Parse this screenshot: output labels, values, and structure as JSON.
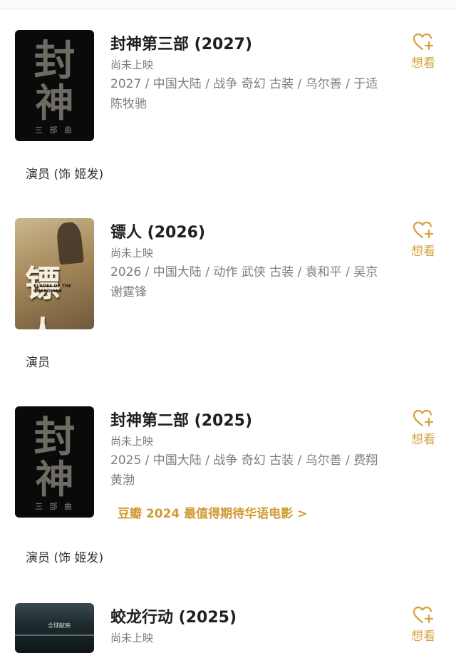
{
  "movies": [
    {
      "title": "封神第三部 (2027)",
      "status": "尚未上映",
      "meta": "2027 / 中国大陆 / 战争 奇幻 古装 / 乌尔善 / 于适 陈牧驰",
      "want_label": "想看",
      "actor_line": "演员 (饰 姬发)"
    },
    {
      "title": "镖人 (2026)",
      "status": "尚未上映",
      "meta": "2026 / 中国大陆 / 动作 武侠 古装 / 袁和平 / 吴京 谢霆锋",
      "want_label": "想看",
      "actor_line": "演员"
    },
    {
      "title": "封神第二部 (2025)",
      "status": "尚未上映",
      "meta": "2025 / 中国大陆 / 战争 奇幻 古装 / 乌尔善 / 费翔 黄渤",
      "douban_link": "豆瓣 2024 最值得期待华语电影 >",
      "want_label": "想看",
      "actor_line": "演员 (饰 姬发)"
    },
    {
      "title": "蛟龙行动 (2025)",
      "status": "尚未上映",
      "want_label": "想看"
    }
  ],
  "colors": {
    "accent": "#d4a23c",
    "title": "#1f1f1f",
    "meta": "#7d7d7d"
  },
  "icons": {
    "want": "heart-plus-icon"
  }
}
